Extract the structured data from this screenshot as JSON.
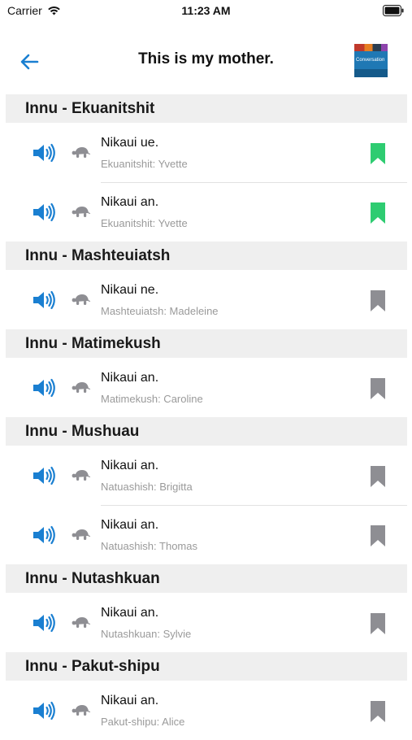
{
  "status_bar": {
    "carrier": "Carrier",
    "time": "11:23 AM"
  },
  "nav": {
    "title": "This is my mother.",
    "back_icon": "arrow-left-icon",
    "cover_label": "Conversation"
  },
  "colors": {
    "accent": "#1a7fd1",
    "bookmark_saved": "#2ecc71",
    "bookmark_default": "#8e8e93",
    "section_bg": "#efefef"
  },
  "sections": [
    {
      "title": "Innu - Ekuanitshit",
      "rows": [
        {
          "phrase": "Nikaui ue.",
          "speaker": "Ekuanitshit: Yvette",
          "bookmarked": true
        },
        {
          "phrase": "Nikaui an.",
          "speaker": "Ekuanitshit: Yvette",
          "bookmarked": true
        }
      ]
    },
    {
      "title": "Innu - Mashteuiatsh",
      "rows": [
        {
          "phrase": "Nikaui ne.",
          "speaker": "Mashteuiatsh: Madeleine",
          "bookmarked": false
        }
      ]
    },
    {
      "title": "Innu - Matimekush",
      "rows": [
        {
          "phrase": "Nikaui an.",
          "speaker": "Matimekush: Caroline",
          "bookmarked": false
        }
      ]
    },
    {
      "title": "Innu - Mushuau",
      "rows": [
        {
          "phrase": "Nikaui an.",
          "speaker": "Natuashish: Brigitta",
          "bookmarked": false
        },
        {
          "phrase": "Nikaui an.",
          "speaker": "Natuashish: Thomas",
          "bookmarked": false
        }
      ]
    },
    {
      "title": "Innu - Nutashkuan",
      "rows": [
        {
          "phrase": "Nikaui an.",
          "speaker": "Nutashkuan: Sylvie",
          "bookmarked": false
        }
      ]
    },
    {
      "title": "Innu - Pakut-shipu",
      "rows": [
        {
          "phrase": "Nikaui an.",
          "speaker": "Pakut-shipu: Alice",
          "bookmarked": false
        }
      ]
    }
  ]
}
